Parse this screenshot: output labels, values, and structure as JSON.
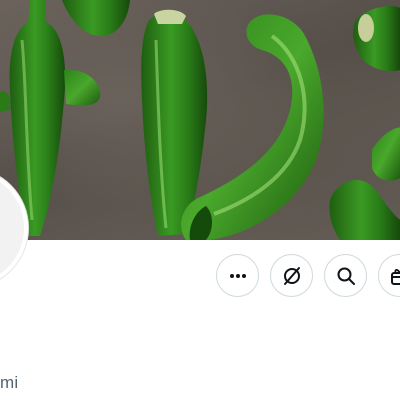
{
  "banner": {
    "description_icon": "banner-image"
  },
  "profile": {
    "handle_partial": "mi"
  },
  "actions": [
    {
      "name": "more-button",
      "icon": "more-icon"
    },
    {
      "name": "grok-button",
      "icon": "grok-icon"
    },
    {
      "name": "search-button",
      "icon": "search-icon"
    },
    {
      "name": "subscribe-button",
      "icon": "gift-icon"
    }
  ],
  "colors": {
    "icon": "#0f1419",
    "button_border": "#cfd9de",
    "handle_text": "#536471",
    "pepper_green": "#2f8a1f"
  }
}
